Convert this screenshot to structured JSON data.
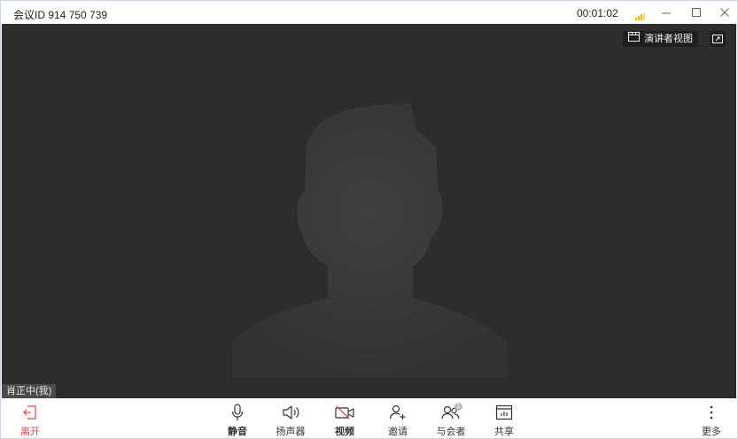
{
  "titlebar": {
    "meeting_id": "会议ID 914 750 739",
    "timer": "00:01:02",
    "signal_color": "#f5b400",
    "window_controls": [
      "minimize-icon",
      "maximize-icon",
      "close-icon"
    ]
  },
  "video": {
    "presenter_view_label": "演讲者视图",
    "participant_name": "肖正中(我)",
    "background_color": "#2d2d2d"
  },
  "toolbar": {
    "leave_label": "离开",
    "mute_label": "静音",
    "speaker_label": "扬声器",
    "video_label": "视频",
    "invite_label": "邀请",
    "participants_label": "与会者",
    "participants_count": "1",
    "share_label": "共享",
    "more_label": "更多",
    "leave_color": "#e64545",
    "video_off_color": "#e64545"
  }
}
